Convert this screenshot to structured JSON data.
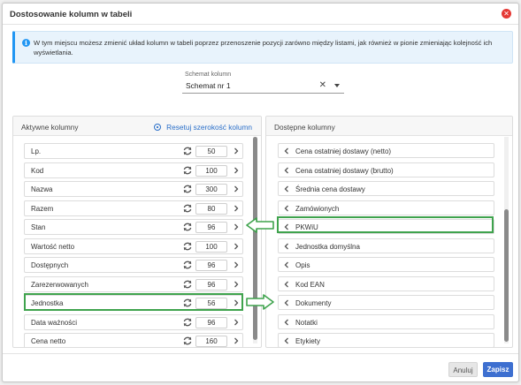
{
  "dialog": {
    "title": "Dostosowanie kolumn w tabeli",
    "info": "W tym miejscu możesz zmienić układ kolumn w tabeli poprzez przenoszenie pozycji zarówno między listami, jak również w pionie zmieniając kolejność ich wyświetlania.",
    "schema": {
      "label": "Schemat kolumn",
      "value": "Schemat nr 1",
      "clear": "✕"
    },
    "left_panel": {
      "title": "Aktywne kolumny",
      "reset_label": "Resetuj szerokość kolumn",
      "items": [
        {
          "label": "Lp.",
          "width": "50"
        },
        {
          "label": "Kod",
          "width": "100"
        },
        {
          "label": "Nazwa",
          "width": "300"
        },
        {
          "label": "Razem",
          "width": "80"
        },
        {
          "label": "Stan",
          "width": "96"
        },
        {
          "label": "Wartość netto",
          "width": "100"
        },
        {
          "label": "Dostępnych",
          "width": "96"
        },
        {
          "label": "Zarezerwowanych",
          "width": "96"
        },
        {
          "label": "Jednostka",
          "width": "56"
        },
        {
          "label": "Data ważności",
          "width": "96"
        },
        {
          "label": "Cena netto",
          "width": "160"
        }
      ]
    },
    "right_panel": {
      "title": "Dostępne kolumny",
      "items": [
        {
          "label": "Cena ostatniej dostawy (netto)"
        },
        {
          "label": "Cena ostatniej dostawy (brutto)"
        },
        {
          "label": "Średnia cena dostawy"
        },
        {
          "label": "Zamówionych"
        },
        {
          "label": "PKWiU"
        },
        {
          "label": "Jednostka domyślna"
        },
        {
          "label": "Opis"
        },
        {
          "label": "Kod EAN"
        },
        {
          "label": "Dokumenty"
        },
        {
          "label": "Notatki"
        },
        {
          "label": "Etykiety"
        }
      ]
    },
    "footer": {
      "cancel": "Anuluj",
      "save": "Zapisz"
    }
  },
  "colors": {
    "accent": "#3d6fd0",
    "highlight": "#3fa34d",
    "close": "#e53935",
    "info_border": "#2196f3"
  }
}
